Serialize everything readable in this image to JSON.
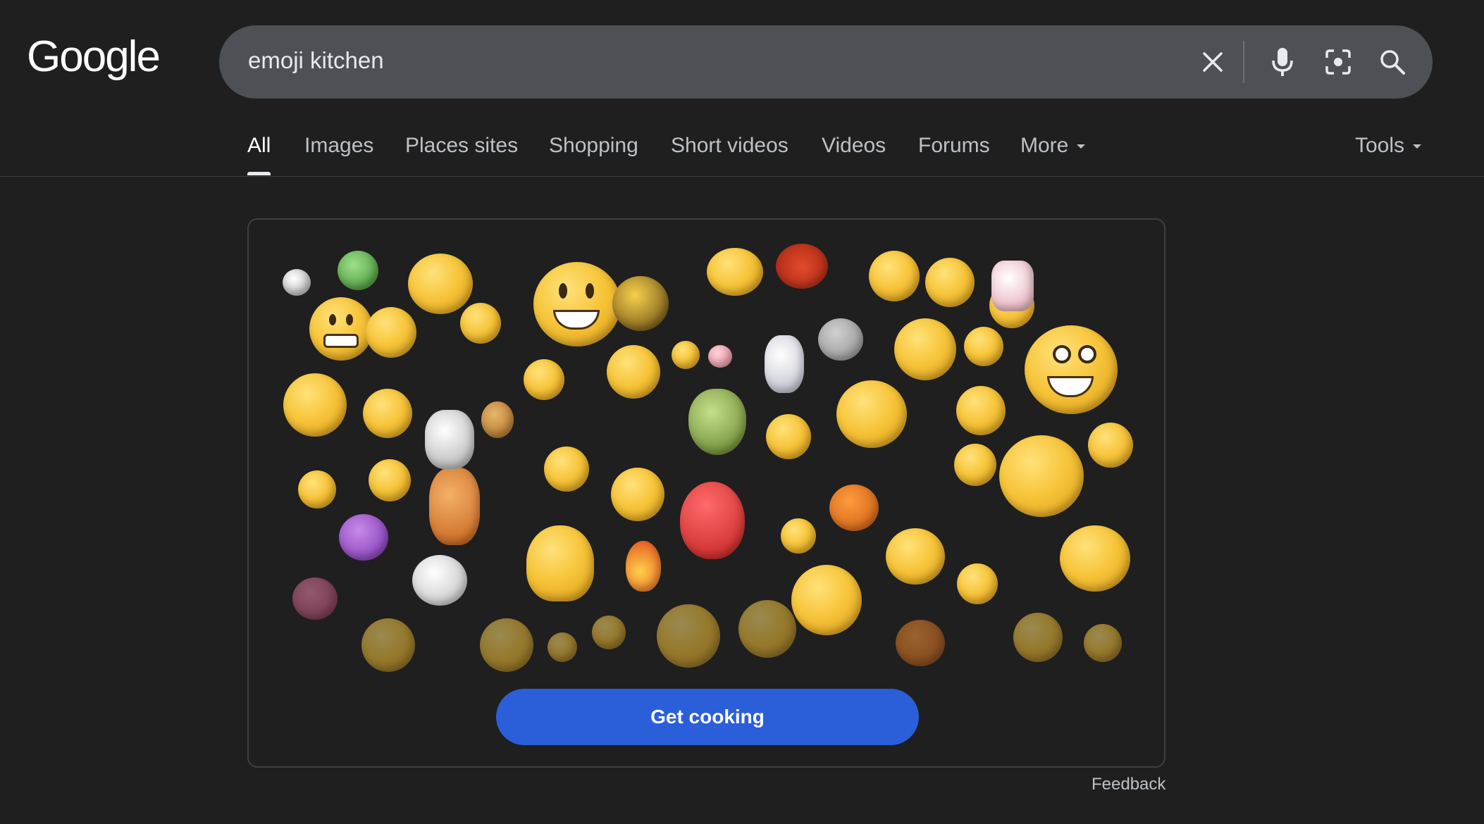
{
  "logo": {
    "text": "Google"
  },
  "search": {
    "query": "emoji kitchen",
    "clear_icon": "close-icon",
    "voice_icon": "microphone-icon",
    "lens_icon": "camera-lens-icon",
    "search_icon": "search-icon"
  },
  "tabs": [
    {
      "label": "All",
      "active": true
    },
    {
      "label": "Images"
    },
    {
      "label": "Places sites"
    },
    {
      "label": "Shopping"
    },
    {
      "label": "Short videos"
    },
    {
      "label": "Videos"
    },
    {
      "label": "Forums"
    },
    {
      "label": "More"
    }
  ],
  "tools": {
    "label": "Tools"
  },
  "card": {
    "button_label": "Get cooking"
  },
  "feedback": {
    "label": "Feedback"
  },
  "colors": {
    "background": "#1f1f1f",
    "searchbar": "#4d5156",
    "button": "#2b5fd9",
    "emoji_yellow": "#f7c53b"
  }
}
